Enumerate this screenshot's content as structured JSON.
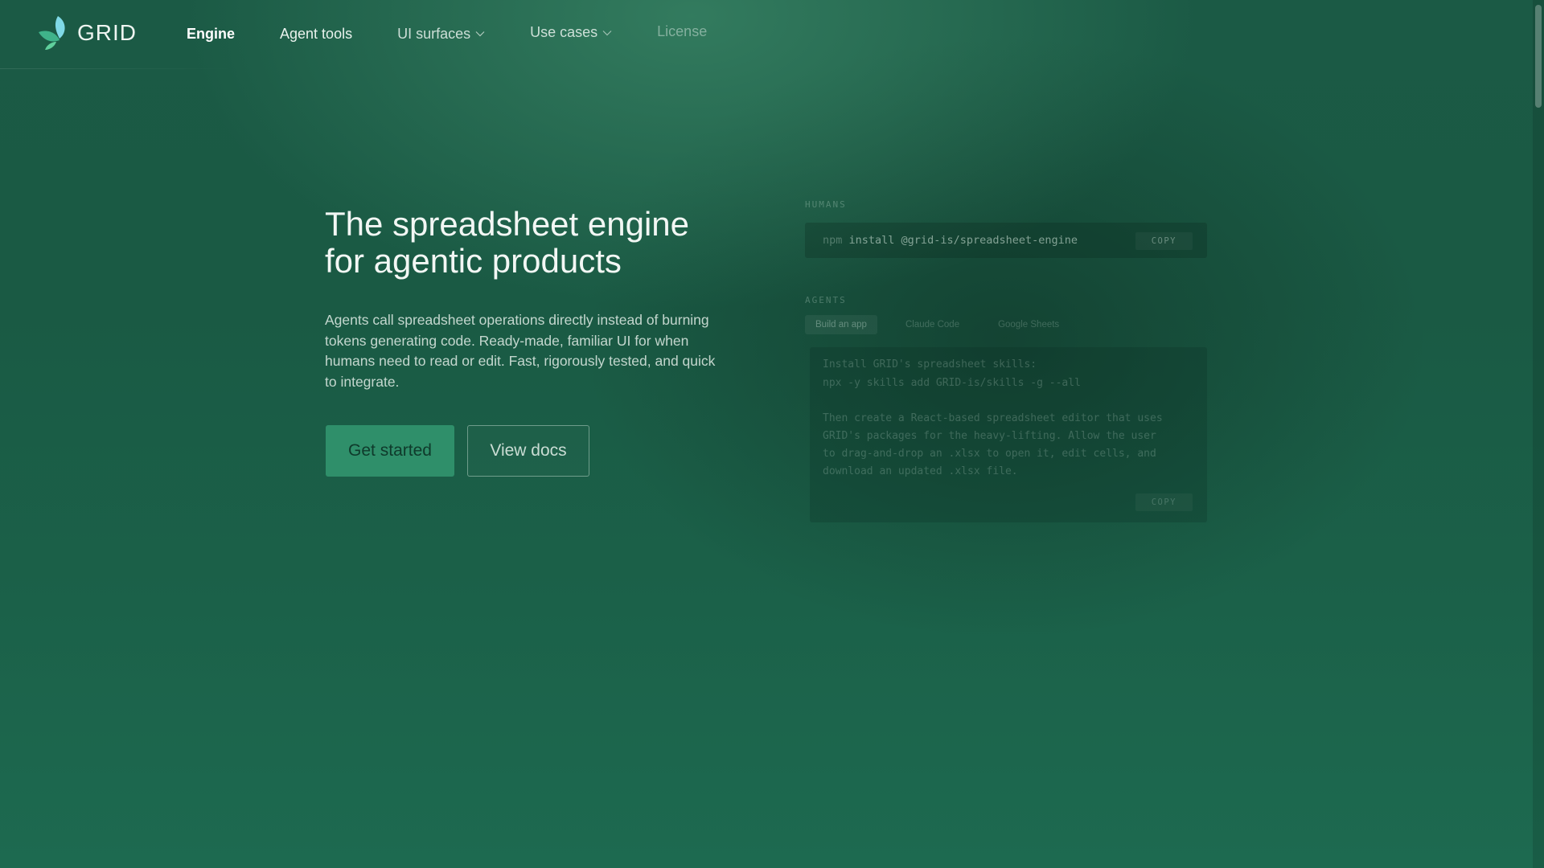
{
  "brand": {
    "name": "GRID",
    "logo_icon": "leaf-logo-icon",
    "logo_colors": [
      "#3fb38a",
      "#5fcf9c",
      "#7fd9e6"
    ]
  },
  "nav": {
    "items": [
      {
        "label": "Engine",
        "active": true
      },
      {
        "label": "Agent tools"
      },
      {
        "label": "UI surfaces",
        "icon": "chevron-down-icon"
      },
      {
        "label": "Use cases",
        "icon": "chevron-down-icon"
      },
      {
        "label": "License"
      }
    ]
  },
  "hero": {
    "title_line1": "The spreadsheet engine",
    "title_line2": "for agentic products",
    "description": "Agents call spreadsheet operations directly instead of burning tokens generating code. Ready-made, familiar UI for when humans need to read or edit. Fast, rigorously tested, and quick to integrate.",
    "primary_cta": "Get started",
    "secondary_cta": "View docs"
  },
  "install_panel": {
    "humans_label": "HUMANS",
    "command_prefix": "npm",
    "command": "install @grid-is/spreadsheet-engine",
    "copy_label": "COPY",
    "agents_label": "AGENTS",
    "tabs": [
      "Build an app",
      "Claude Code",
      "Google Sheets"
    ],
    "prompt_lines": [
      "Install GRID's spreadsheet skills:",
      "npx -y skills add GRID-is/skills -g --all",
      "",
      "Then create a React-based spreadsheet editor that uses",
      "GRID's packages for the heavy-lifting. Allow the user",
      "to drag-and-drop an .xlsx to open it, edit cells, and",
      "download an updated .xlsx file."
    ],
    "prompt_copy_label": "COPY"
  },
  "colors": {
    "background": "#1b5a45",
    "primary_button": "#2f8f6a",
    "primary_button_text": "#0f3a2b"
  }
}
